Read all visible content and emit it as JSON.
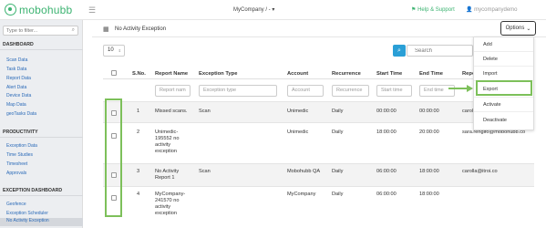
{
  "topbar": {
    "logo_text": "mobohubb",
    "company": "MyCompany / -",
    "company_caret": "▾",
    "help": "Help & Support",
    "user": "mycompanydemo"
  },
  "sidebar": {
    "filter_placeholder": "Type to filter...",
    "sections": [
      {
        "title": "DASHBOARD",
        "items": [
          "Scan Data",
          "Task Data",
          "Report Data",
          "Alert Data",
          "Device Data",
          "Map Data",
          "geoTasks Data"
        ]
      },
      {
        "title": "PRODUCTIVITY",
        "items": [
          "Exception Data",
          "Time Studies",
          "Timesheet",
          "Approvals"
        ]
      },
      {
        "title": "EXCEPTION DASHBOARD",
        "items": [
          "Geofence",
          "Exception Scheduler",
          "No Activity Exception"
        ]
      }
    ]
  },
  "header": {
    "title": "No Activity Exception",
    "options_label": "Options"
  },
  "toolbar": {
    "page_size": "10",
    "search_placeholder": "Search"
  },
  "options_menu": {
    "items": [
      "Add",
      "Delete",
      "Import",
      "Export",
      "Activate",
      "Deactivate"
    ]
  },
  "table": {
    "columns": [
      "S.No.",
      "Report Name",
      "Exception Type",
      "Account",
      "Recurrence",
      "Start Time",
      "End Time",
      "Repo"
    ],
    "filters": [
      "Report nam",
      "Exception type",
      "Account",
      "Recurrence",
      "Start time",
      "End time"
    ],
    "rows": [
      {
        "sno": "1",
        "name": [
          "Missed scans."
        ],
        "type": "Scan",
        "account": "Unimedic",
        "recurrence": "Daily",
        "start": "00:00:00",
        "end": "00:00:00",
        "report": "carol"
      },
      {
        "sno": "2",
        "name": [
          "Unimedic-",
          "195552 no",
          "activity",
          "exception"
        ],
        "type": "",
        "account": "Unimedic",
        "recurrence": "Daily",
        "start": "18:00:00",
        "end": "20:00:00",
        "report": "sara.rengifo@mobohubb.co"
      },
      {
        "sno": "3",
        "name": [
          "No Activity",
          "Report 1"
        ],
        "type": "Scan",
        "account": "Mobohubb QA",
        "recurrence": "Daily",
        "start": "06:00:00",
        "end": "18:00:00",
        "report": "carolla@itroi.co"
      },
      {
        "sno": "4",
        "name": [
          "MyCompany-",
          "241570 no",
          "activity",
          "exception"
        ],
        "type": "",
        "account": "MyCompany",
        "recurrence": "Daily",
        "start": "06:00:00",
        "end": "18:00:00",
        "report": ""
      }
    ]
  },
  "colors": {
    "accent": "#3cb371",
    "highlight": "#7dc05a",
    "link": "#2a6ab8",
    "primary_button": "#2a9fd6"
  }
}
